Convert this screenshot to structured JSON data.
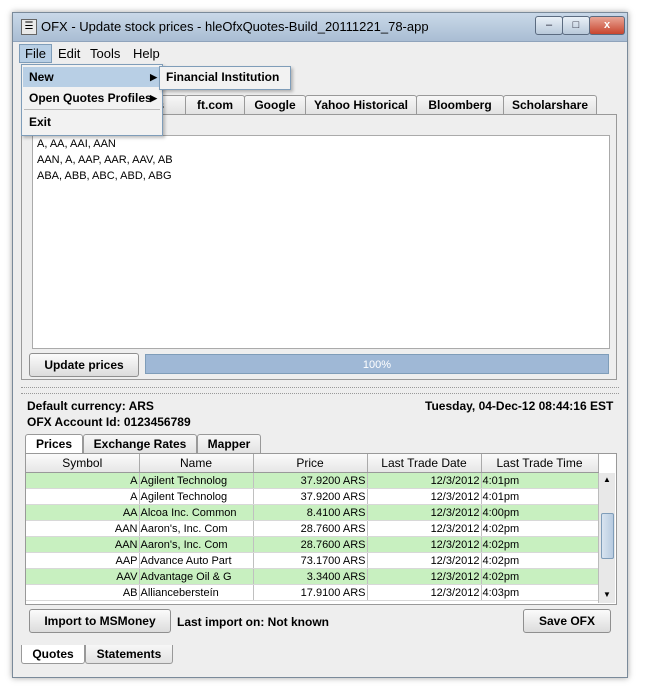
{
  "window": {
    "title": "OFX - Update stock prices - hleOfxQuotes-Build_20111221_78-app",
    "minimize": "–",
    "maximize": "□",
    "close": "x"
  },
  "menubar": {
    "file": "File",
    "edit": "Edit",
    "tools": "Tools",
    "help": "Help"
  },
  "file_menu": {
    "new": "New",
    "open_quotes_profiles": "Open Quotes Profiles",
    "exit": "Exit",
    "submenu_arrow": "▶"
  },
  "new_submenu": {
    "financial_institution": "Financial Institution"
  },
  "quote_sources": {
    "tabs": [
      "...us",
      "ft.com",
      "Google",
      "Yahoo Historical",
      "Bloomberg",
      "Scholarshare"
    ]
  },
  "symbols_text": [
    "A, AA, AAI, AAN",
    "AAN, A, AAP, AAR, AAV, AB",
    "ABA, ABB, ABC, ABD, ABG"
  ],
  "update": {
    "button": "Update prices",
    "progress": "100%"
  },
  "info": {
    "default_currency": "Default currency: ARS",
    "account_id": "OFX Account Id: 0123456789",
    "datetime": "Tuesday, 04-Dec-12 08:44:16 EST"
  },
  "result_tabs": [
    "Prices",
    "Exchange Rates",
    "Mapper"
  ],
  "prices_table": {
    "columns": [
      "Symbol",
      "Name",
      "Price",
      "Last Trade Date",
      "Last Trade Time"
    ],
    "rows": [
      {
        "symbol": "A",
        "name": "Agilent Technolog",
        "price": "37.9200 ARS",
        "date": "12/3/2012",
        "time": "4:01pm",
        "highlight": true
      },
      {
        "symbol": "A",
        "name": "Agilent Technolog",
        "price": "37.9200 ARS",
        "date": "12/3/2012",
        "time": "4:01pm",
        "highlight": false
      },
      {
        "symbol": "AA",
        "name": "Alcoa Inc. Common",
        "price": "8.4100 ARS",
        "date": "12/3/2012",
        "time": "4:00pm",
        "highlight": true
      },
      {
        "symbol": "AAN",
        "name": "Aaron's, Inc. Com",
        "price": "28.7600 ARS",
        "date": "12/3/2012",
        "time": "4:02pm",
        "highlight": false
      },
      {
        "symbol": "AAN",
        "name": "Aaron's, Inc. Com",
        "price": "28.7600 ARS",
        "date": "12/3/2012",
        "time": "4:02pm",
        "highlight": true
      },
      {
        "symbol": "AAP",
        "name": "Advance Auto Part",
        "price": "73.1700 ARS",
        "date": "12/3/2012",
        "time": "4:02pm",
        "highlight": false
      },
      {
        "symbol": "AAV",
        "name": "Advantage Oil & G",
        "price": "3.3400 ARS",
        "date": "12/3/2012",
        "time": "4:02pm",
        "highlight": true
      },
      {
        "symbol": "AB",
        "name": "Alliancebersteín",
        "price": "17.9100 ARS",
        "date": "12/3/2012",
        "time": "4:03pm",
        "highlight": false
      }
    ]
  },
  "import": {
    "button": "Import to MSMoney",
    "last_import": "Last import on: Not known",
    "save_button": "Save OFX"
  },
  "bottom_tabs": [
    "Quotes",
    "Statements"
  ],
  "scrollbar": {
    "up": "▲",
    "down": "▼"
  },
  "colors": {
    "highlight_row": "#c8f0c0",
    "menu_highlight": "#b8cfe5",
    "progress": "#9fb8d6"
  }
}
